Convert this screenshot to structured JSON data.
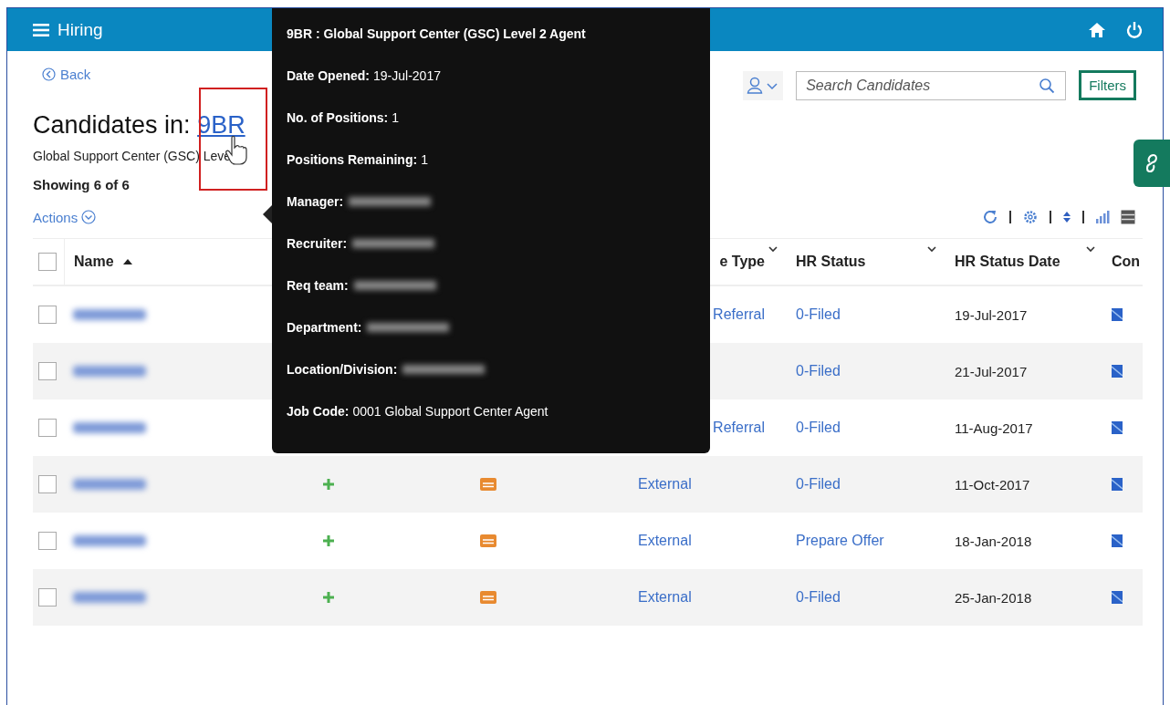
{
  "app_bar": {
    "title": "Hiring"
  },
  "back": "Back",
  "heading": {
    "label": "Candidates in:",
    "req": "9BR"
  },
  "subtitle": "Global Support Center (GSC) Leve",
  "count": "Showing 6 of 6",
  "actions": "Actions",
  "search": {
    "placeholder": "Search Candidates"
  },
  "filters": "Filters",
  "table": {
    "select_all": {
      "checked": false
    },
    "columns": [
      {
        "label": "Name",
        "sorted": true,
        "menu": false
      },
      {
        "label": "e Type",
        "sorted": false,
        "menu": true,
        "clipped_left": true
      },
      {
        "label": "HR Status",
        "sorted": false,
        "menu": true
      },
      {
        "label": "HR Status Date",
        "sorted": false,
        "menu": true
      },
      {
        "label": "Con",
        "sorted": false,
        "menu": false
      }
    ],
    "rows": [
      {
        "checked": false,
        "source": "Referral",
        "source_clipped_left": true,
        "hr_status": "0-Filed",
        "date": "19-Jul-2017"
      },
      {
        "checked": false,
        "hr_status": "0-Filed",
        "date": "21-Jul-2017"
      },
      {
        "checked": false,
        "source": "Referral",
        "source_clipped_left": true,
        "hr_status": "0-Filed",
        "date": "11-Aug-2017"
      },
      {
        "checked": false,
        "icons": true,
        "source": "External",
        "hr_status": "0-Filed",
        "date": "11-Oct-2017"
      },
      {
        "checked": false,
        "icons": true,
        "source": "External",
        "hr_status": "Prepare Offer",
        "date": "18-Jan-2018"
      },
      {
        "checked": false,
        "icons": true,
        "source": "External",
        "hr_status": "0-Filed",
        "date": "25-Jan-2018"
      }
    ]
  },
  "tooltip": {
    "title": "9BR : Global Support Center (GSC) Level 2 Agent",
    "fields": [
      {
        "label": "Date Opened:",
        "value": "19-Jul-2017",
        "redacted": false
      },
      {
        "label": "No. of Positions:",
        "value": "1",
        "redacted": false
      },
      {
        "label": "Positions Remaining:",
        "value": "1",
        "redacted": false
      },
      {
        "label": "Manager:",
        "redacted": true
      },
      {
        "label": "Recruiter:",
        "redacted": true
      },
      {
        "label": "Req team:",
        "redacted": true
      },
      {
        "label": "Department:",
        "redacted": true
      },
      {
        "label": "Location/Division:",
        "redacted": true
      },
      {
        "label": "Job Code:",
        "value": "0001 Global Support Center Agent",
        "redacted": false
      }
    ]
  }
}
